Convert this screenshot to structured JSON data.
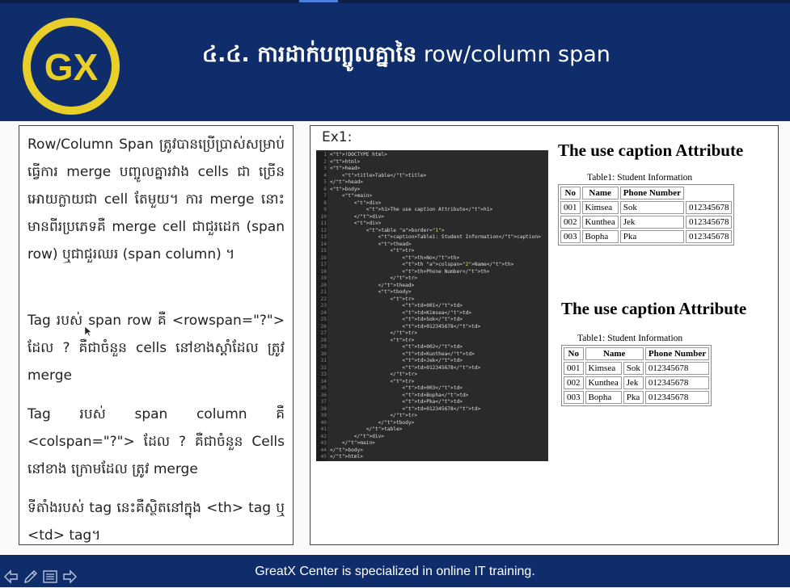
{
  "header": {
    "title_kh": "៤.៤. ការដាក់បញ្ចូលគ្នានៃ",
    "title_en": "row/column span",
    "logo_text": "GX"
  },
  "left_panel": {
    "paragraphs": [
      "Row/Column Span ត្រូវបានប្រើប្រាស់សម្រាប់ធ្វើការ merge បញ្ចូលគ្នារវាង cells ជា ច្រើនអោយក្លាយជា cell តែមួយ។ ការ merge នោះមានពីរប្រភេទគឺ merge cell ជាជួរដេក (span row) ឬជាជួរឈរ (span column) ។",
      "Tag របស់ span row គឺ <rowspan=\"?\"> ដែល ? គឺជាចំនួន cells នៅខាងស្តាំដែល ត្រូវ merge",
      "Tag របស់ span column គឺ <colspan=\"?\"> ដែល ? គឺជាចំនួន Cells នៅខាង ក្រោមដែល ត្រូវ merge",
      "ទីតាំងរបស់ tag នេះគឺស្ថិតនៅក្នុង <th> tag ឬ <td> tag។"
    ]
  },
  "right_panel": {
    "example_label": "Ex1:",
    "code_lines": [
      "<!DOCTYPE html>",
      "<html>",
      "<head>",
      "    <title>Table</title>",
      "</head>",
      "<body>",
      "    <main>",
      "        <div>",
      "            <h1>The use caption Attribute</h1>",
      "        </div>",
      "        <div>",
      "            <table border=\"1\">",
      "                <caption>Table1: Student Information</caption>",
      "                <thead>",
      "                    <tr>",
      "                        <th>No</th>",
      "                        <th colspan=\"2\">Name</th>",
      "                        <th>Phone Number</th>",
      "                    </tr>",
      "                </thead>",
      "                <tbody>",
      "                    <tr>",
      "                        <td>001</td>",
      "                        <td>Kimsea</td>",
      "                        <td>Sok</td>",
      "                        <td>012345678</td>",
      "                    </tr>",
      "                    <tr>",
      "                        <td>002</td>",
      "                        <td>Kunthea</td>",
      "                        <td>Jek</td>",
      "                        <td>012345678</td>",
      "                    </tr>",
      "                    <tr>",
      "                        <td>003</td>",
      "                        <td>Bopha</td>",
      "                        <td>Pka</td>",
      "                        <td>012345678</td>",
      "                    </tr>",
      "                </tbody>",
      "            </table>",
      "        </div>",
      "    </main>",
      "</body>",
      "</html>"
    ],
    "demo1": {
      "heading": "The use caption Attribute",
      "caption": "Table1: Student Information",
      "headers": [
        "No",
        "Name",
        "Phone Number"
      ],
      "rows": [
        [
          "001",
          "Kimsea",
          "Sok",
          "012345678"
        ],
        [
          "002",
          "Kunthea",
          "Jek",
          "012345678"
        ],
        [
          "003",
          "Bopha",
          "Pka",
          "012345678"
        ]
      ]
    },
    "demo2": {
      "heading": "The use caption Attribute",
      "caption": "Table1: Student Information",
      "headers": [
        "No",
        "Name",
        "Phone Number"
      ],
      "rows": [
        [
          "001",
          "Kimsea",
          "Sok",
          "012345678"
        ],
        [
          "002",
          "Kunthea",
          "Jek",
          "012345678"
        ],
        [
          "003",
          "Bopha",
          "Pka",
          "012345678"
        ]
      ]
    }
  },
  "footer": {
    "text": "GreatX Center is specialized in online IT training.",
    "tools": [
      "prev-arrow-icon",
      "pen-icon",
      "menu-icon",
      "next-arrow-icon"
    ]
  },
  "colors": {
    "header_bg": "#102d6b",
    "logo_gold": "#e9cf2a",
    "editor_bg": "#2a2a2a"
  }
}
